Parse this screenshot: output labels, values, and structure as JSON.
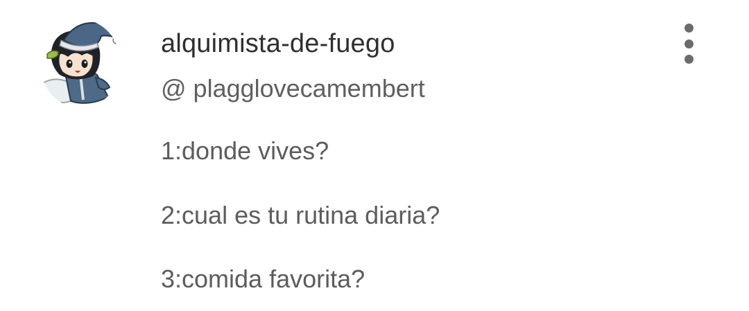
{
  "comment": {
    "username": "alquimista-de-fuego",
    "handle_prefix": "@",
    "handle": "plagglovecamembert",
    "lines": [
      "1:donde vives?",
      "2:cual es tu rutina diaria?",
      "3:comida favorita?"
    ]
  },
  "icons": {
    "more": "more-vertical-icon",
    "avatar": "chibi-character-avatar"
  },
  "colors": {
    "username": "#2f2f2f",
    "text": "#5c5c5c",
    "dots": "#6b6b6b"
  }
}
